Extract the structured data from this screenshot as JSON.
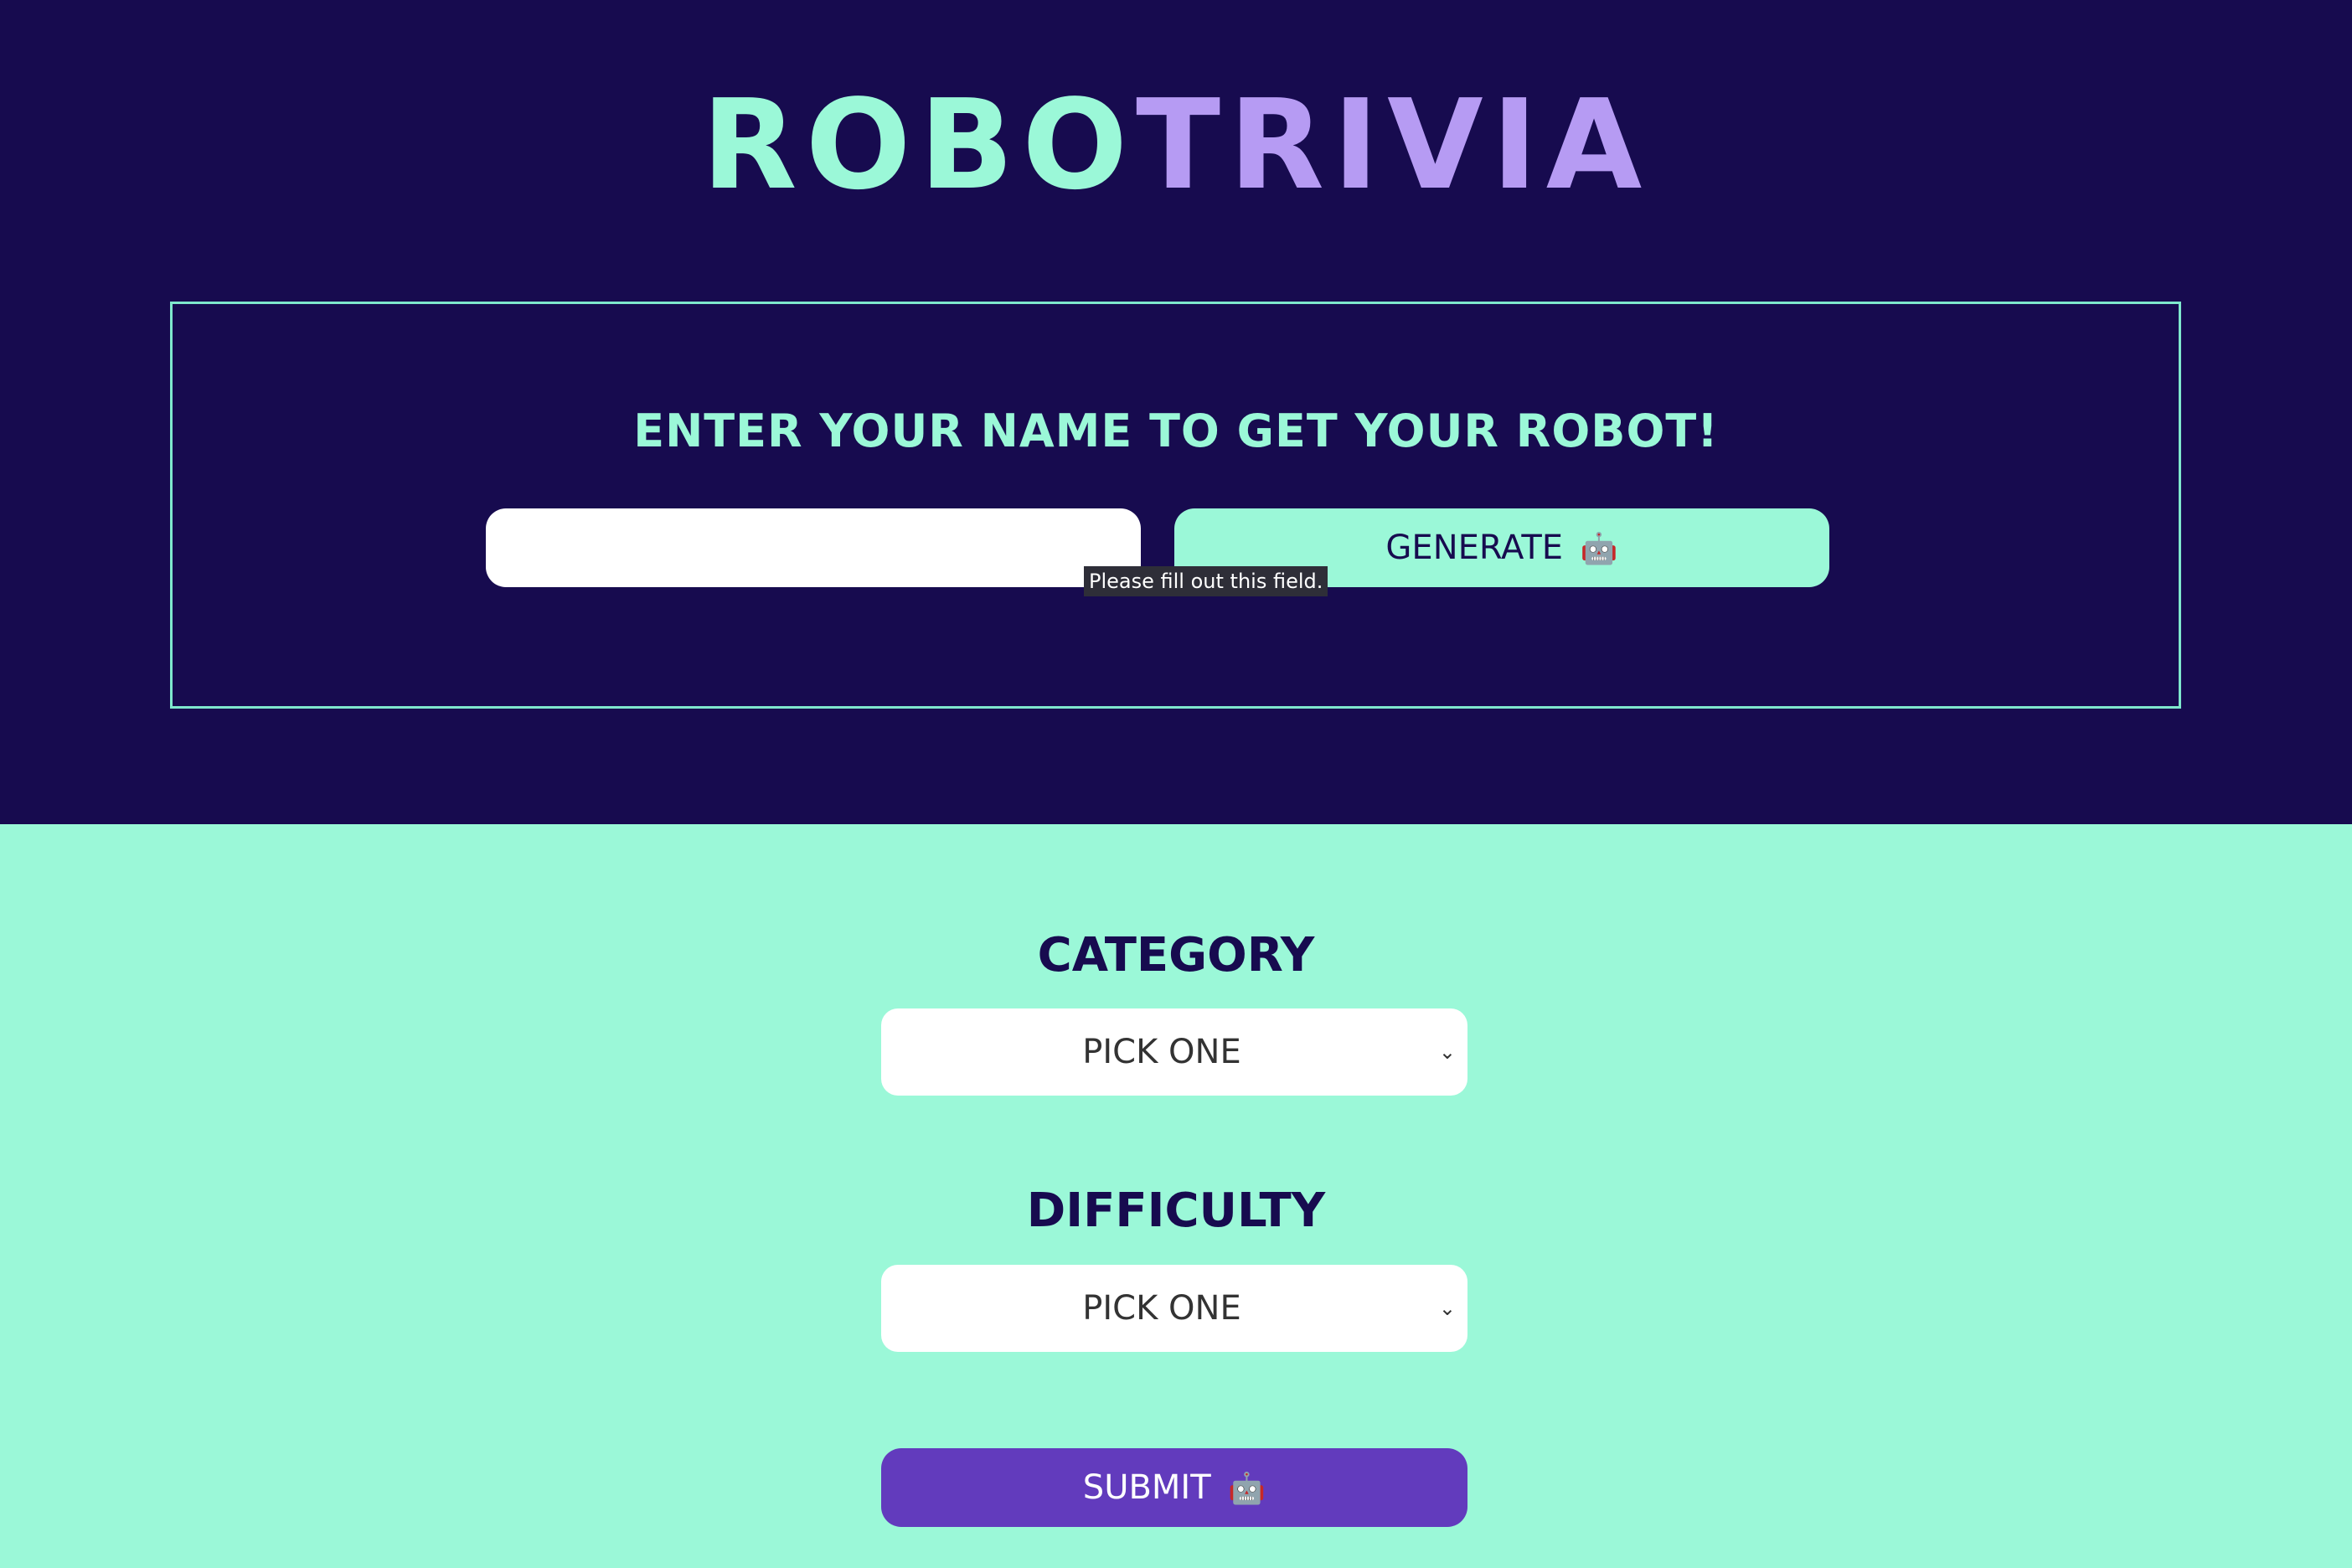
{
  "header": {
    "title_part1": "ROBO",
    "title_part2": "TRIVIA"
  },
  "name_form": {
    "heading": "ENTER YOUR NAME TO GET YOUR ROBOT!",
    "input_value": "",
    "generate_label": "GENERATE",
    "robot_icon": "🤖",
    "validation_tooltip": "Please fill out this field."
  },
  "quiz_form": {
    "category_label": "CATEGORY",
    "category_selected": "PICK ONE",
    "difficulty_label": "DIFFICULTY",
    "difficulty_selected": "PICK ONE",
    "submit_label": "SUBMIT",
    "chevron_glyph": "⌄"
  },
  "colors": {
    "dark_bg": "#170b4f",
    "mint": "#9bf8d8",
    "lavender": "#b69bf3",
    "purple_button": "#623bbd"
  }
}
